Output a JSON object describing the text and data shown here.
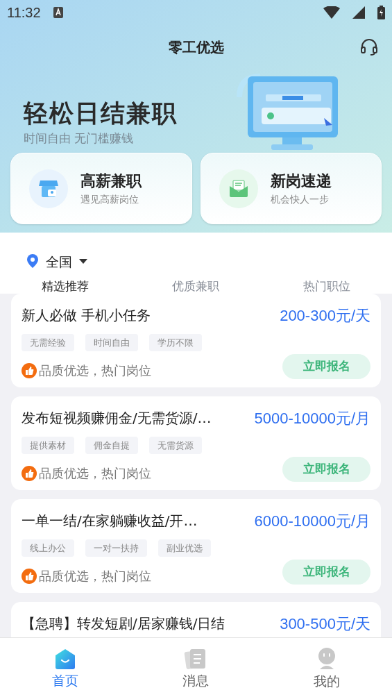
{
  "status_bar": {
    "time": "11:32"
  },
  "header": {
    "title": "零工优选"
  },
  "banner": {
    "headline": "轻松日结兼职",
    "subtitle": "时间自由 无门槛赚钱"
  },
  "quick_links": [
    {
      "kind": "shop",
      "title": "高薪兼职",
      "subtitle": "遇见高薪岗位"
    },
    {
      "kind": "mail",
      "title": "新岗速递",
      "subtitle": "机会快人一步"
    }
  ],
  "location": "全国",
  "tabs": [
    {
      "label": "精选推荐",
      "selected": true
    },
    {
      "label": "优质兼职",
      "selected": false
    },
    {
      "label": "热门职位",
      "selected": false
    }
  ],
  "jobs": [
    {
      "title": "新人必做 手机小任务",
      "salary": "200-300元/天",
      "tags": [
        "无需经验",
        "时间自由",
        "学历不限"
      ],
      "note": "品质优选，热门岗位",
      "button": "立即报名"
    },
    {
      "title": "发布短视频赚佣金/无需货源/…",
      "salary": "5000-10000元/月",
      "tags": [
        "提供素材",
        "佣金自提",
        "无需货源"
      ],
      "note": "品质优选，热门岗位",
      "button": "立即报名"
    },
    {
      "title": "一单一结/在家躺赚收益/开…",
      "salary": "6000-10000元/月",
      "tags": [
        "线上办公",
        "一对一扶持",
        "副业优选"
      ],
      "note": "品质优选，热门岗位",
      "button": "立即报名"
    },
    {
      "title": "【急聘】转发短剧/居家赚钱/日结",
      "salary": "300-500元/天"
    }
  ],
  "bottom_nav": [
    {
      "kind": "home",
      "label": "首页",
      "selected": true
    },
    {
      "kind": "messages",
      "label": "消息",
      "selected": false
    },
    {
      "kind": "profile",
      "label": "我的",
      "selected": false
    }
  ]
}
